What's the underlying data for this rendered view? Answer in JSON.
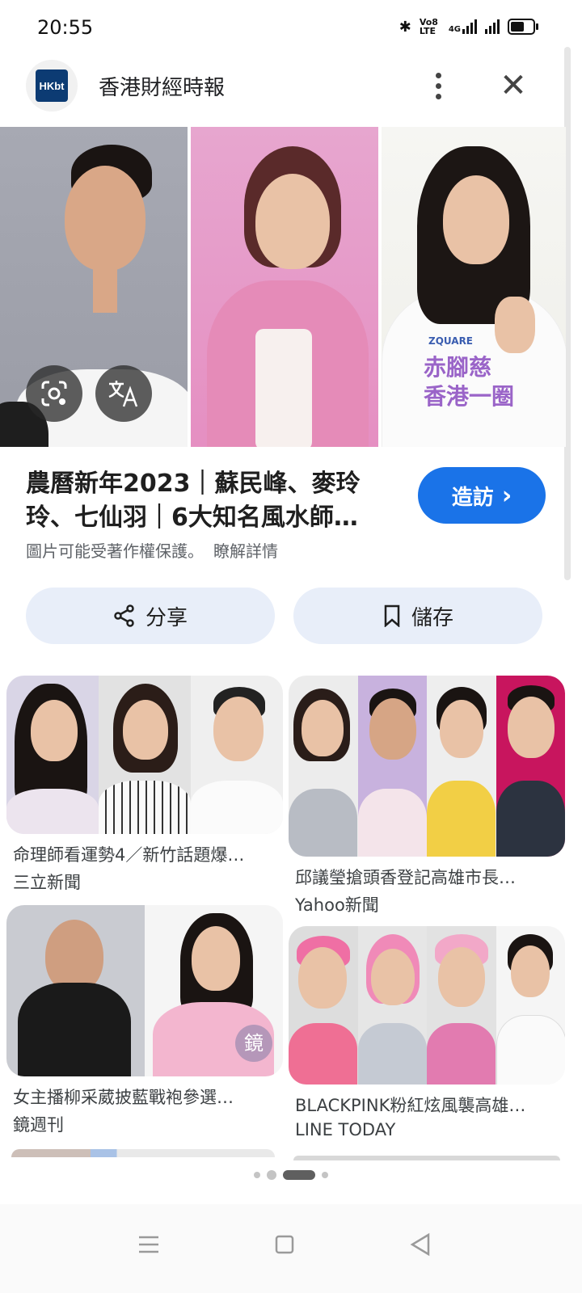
{
  "status_bar": {
    "time": "20:55",
    "icons": [
      "bluetooth-icon",
      "volte-icon",
      "4g-signal-icon",
      "signal-icon",
      "battery-icon"
    ],
    "volte_label": "Vo8 LTE",
    "network_label": "4G"
  },
  "header": {
    "logo_text": "HKbt",
    "source_name": "香港財經時報",
    "more_icon": "more-vert-icon",
    "close_icon": "close-icon"
  },
  "hero": {
    "lens_icon": "google-lens-icon",
    "translate_icon": "translate-icon",
    "shirt_text": "赤腳慈 香港一圈",
    "shirt_brand": "ZQUARE"
  },
  "result": {
    "title": "農曆新年2023｜蘇民峰、麥玲玲、七仙羽｜6大知名風水師…",
    "visit_label": "造訪",
    "visit_chevron": "›",
    "copyright_text": "圖片可能受著作權保護。",
    "learn_more": "瞭解詳情",
    "share_label": "分享",
    "save_label": "儲存"
  },
  "related": [
    {
      "title": "命理師看運勢4／新竹話題爆…",
      "source": "三立新聞"
    },
    {
      "title": "邱議瑩搶頭香登記高雄市長…",
      "source": "Yahoo新聞"
    },
    {
      "title": "女主播柳采葳披藍戰袍參選…",
      "source": "鏡週刊"
    },
    {
      "title": "BLACKPINK粉紅炫風襲高雄…",
      "source": "LINE TODAY"
    }
  ],
  "watermark_text": "鏡",
  "pager": {
    "count": 4,
    "active": 2
  },
  "colors": {
    "accent": "#1a73e8",
    "chip_bg": "#e8eef9",
    "text": "#1f1f1f",
    "secondary": "#5f6368"
  }
}
